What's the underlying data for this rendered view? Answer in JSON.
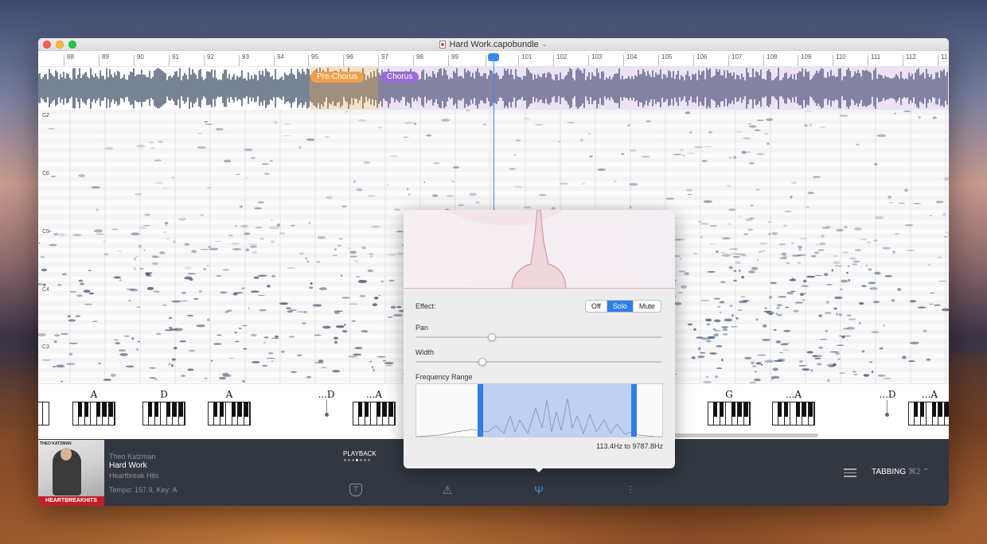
{
  "window": {
    "title": "Hard Work.capobundle"
  },
  "ruler": {
    "bars": [
      "88",
      "89",
      "90",
      "91",
      "92",
      "93",
      "94",
      "95",
      "96",
      "97",
      "98",
      "99",
      "100",
      "101",
      "102",
      "103",
      "104",
      "105",
      "106",
      "107",
      "108",
      "109",
      "110",
      "111",
      "112",
      "11"
    ]
  },
  "sections": {
    "pre_chorus": "Pre-Chorus",
    "chorus": "Chorus"
  },
  "note_labels": [
    "C7",
    "C6",
    "C5",
    "C4",
    "C3"
  ],
  "chords": [
    "A",
    "D",
    "A",
    "...D",
    "...A",
    "G",
    "...A",
    "...D",
    "...A"
  ],
  "track": {
    "artist": "Theo Katzman",
    "title": "Hard Work",
    "album": "Heartbreak Hits",
    "meta": "Tempo: 157.9, Key: A"
  },
  "album_art": {
    "top_text": "THEO KATZMAN",
    "bottom_text": "HEARTBREAKHITS"
  },
  "playback": {
    "label": "PLAYBACK"
  },
  "bottom": {
    "mode_label": "TABBING",
    "mode_shortcut": "⌘2 ⌃"
  },
  "popover": {
    "effect_label": "Effect:",
    "effect_options": [
      "Off",
      "Solo",
      "Mute"
    ],
    "effect_selected": "Solo",
    "pan_label": "Pan",
    "pan_value": 0.31,
    "width_label": "Width",
    "width_value": 0.27,
    "freq_label": "Frequency Range",
    "freq_readout": "113.4Hz to 9787.8Hz"
  },
  "colors": {
    "accent": "#3a8be8",
    "pre_chorus": "#f0a04b",
    "chorus": "#9a6ad6",
    "bar_bg": "#323741"
  },
  "icons": [
    "tab-icon",
    "triangle-icon",
    "tuning-fork-icon",
    "mixer-icon",
    "settings-sliders-icon"
  ]
}
